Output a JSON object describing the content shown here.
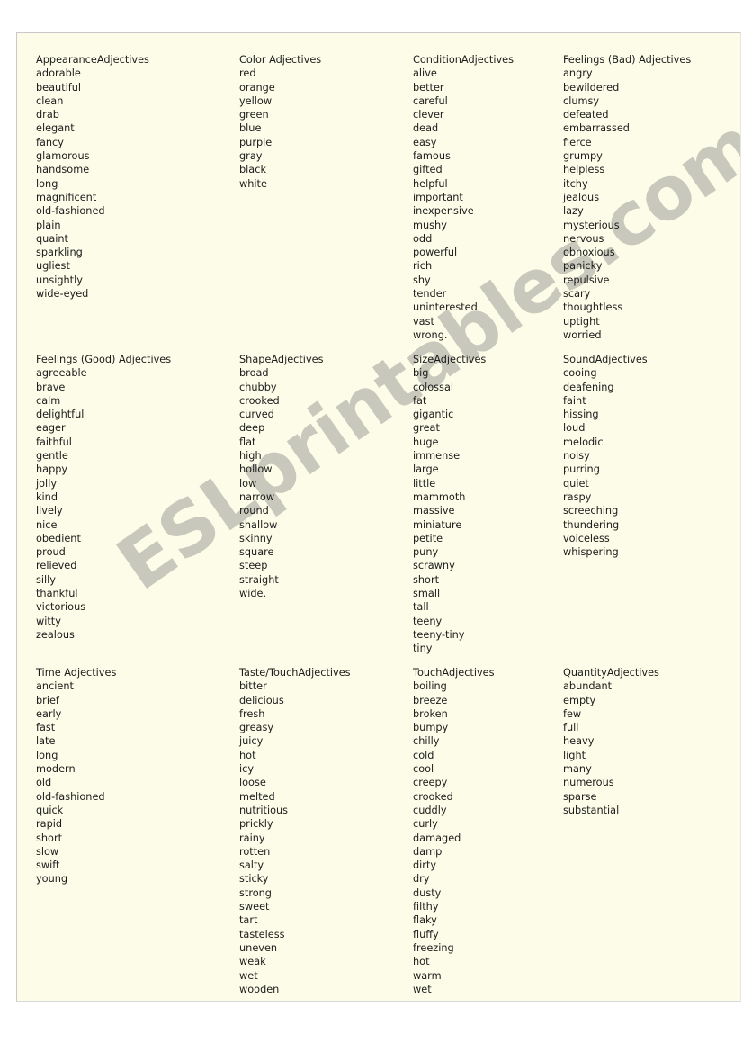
{
  "document": {
    "title": "Adjectives Word Bank",
    "watermark": "ESLprintables.com",
    "page_background": "#fcfce8",
    "text_color": "#1c1c1c",
    "watermark_color": "#c8c8bc"
  },
  "sections": [
    {
      "columns": [
        {
          "title": "AppearanceAdjectives",
          "words": [
            "adorable",
            "beautiful",
            "clean",
            "drab",
            "elegant",
            "fancy",
            "glamorous",
            "handsome",
            "long",
            "magnificent",
            "old-fashioned",
            "plain",
            "quaint",
            "sparkling",
            "ugliest",
            "unsightly",
            "wide-eyed"
          ]
        },
        {
          "title": "Color Adjectives",
          "words": [
            "red",
            "orange",
            "yellow",
            "green",
            "blue",
            "purple",
            "gray",
            "black",
            "white"
          ]
        },
        {
          "title": "ConditionAdjectives",
          "words": [
            "alive",
            "better",
            "careful",
            "clever",
            "dead",
            "easy",
            "famous",
            "gifted",
            "helpful",
            "important",
            "inexpensive",
            "mushy",
            "odd",
            "powerful",
            "rich",
            "shy",
            "tender",
            "uninterested",
            "vast",
            "wrong."
          ]
        },
        {
          "title": "Feelings (Bad) Adjectives",
          "words": [
            "angry",
            "bewildered",
            "clumsy",
            "defeated",
            "embarrassed",
            "fierce",
            "grumpy",
            "helpless",
            "itchy",
            "jealous",
            "lazy",
            "mysterious",
            "nervous",
            "obnoxious",
            "panicky",
            "repulsive",
            "scary",
            "thoughtless",
            "uptight",
            "worried"
          ]
        }
      ]
    },
    {
      "columns": [
        {
          "title": "Feelings (Good) Adjectives",
          "words": [
            "agreeable",
            "brave",
            "calm",
            "delightful",
            "eager",
            "faithful",
            "gentle",
            "happy",
            "jolly",
            "kind",
            "lively",
            "nice",
            "obedient",
            "proud",
            "relieved",
            "silly",
            "thankful",
            "victorious",
            "witty",
            "zealous"
          ]
        },
        {
          "title": "ShapeAdjectives",
          "words": [
            "broad",
            "chubby",
            "crooked",
            "curved",
            "deep",
            "flat",
            "high",
            "hollow",
            "low",
            "narrow",
            "round",
            "shallow",
            "skinny",
            "square",
            "steep",
            "straight",
            "wide."
          ]
        },
        {
          "title": "SizeAdjectives",
          "words": [
            "big",
            "colossal",
            "fat",
            "gigantic",
            "great",
            "huge",
            "immense",
            "large",
            "little",
            "mammoth",
            "massive",
            "miniature",
            "petite",
            "puny",
            "scrawny",
            "short",
            "small",
            "tall",
            "teeny",
            "teeny-tiny",
            "tiny"
          ]
        },
        {
          "title": "SoundAdjectives",
          "words": [
            "cooing",
            "deafening",
            "faint",
            "hissing",
            "loud",
            "melodic",
            "noisy",
            "purring",
            "quiet",
            "raspy",
            "screeching",
            "thundering",
            "voiceless",
            "whispering"
          ]
        }
      ]
    },
    {
      "columns": [
        {
          "title": "Time Adjectives",
          "words": [
            "ancient",
            "brief",
            "early",
            "fast",
            "late",
            "long",
            "modern",
            "old",
            "old-fashioned",
            "quick",
            "rapid",
            "short",
            "slow",
            "swift",
            "young"
          ]
        },
        {
          "title": "Taste/TouchAdjectives",
          "words": [
            "bitter",
            "delicious",
            "fresh",
            "greasy",
            "juicy",
            "hot",
            "icy",
            "loose",
            "melted",
            "nutritious",
            "prickly",
            "rainy",
            "rotten",
            "salty",
            "sticky",
            "strong",
            "sweet",
            "tart",
            "tasteless",
            "uneven",
            "weak",
            "wet",
            "wooden"
          ]
        },
        {
          "title": "TouchAdjectives",
          "words": [
            "boiling",
            "breeze",
            "broken",
            "bumpy",
            "chilly",
            "cold",
            "cool",
            "creepy",
            "crooked",
            "cuddly",
            "curly",
            "damaged",
            "damp",
            "dirty",
            "dry",
            "dusty",
            "filthy",
            "flaky",
            "fluffy",
            "freezing",
            "hot",
            "warm",
            "wet"
          ]
        },
        {
          "title": "QuantityAdjectives",
          "words": [
            "abundant",
            "empty",
            "few",
            "full",
            "heavy",
            "light",
            "many",
            "numerous",
            "sparse",
            "substantial"
          ]
        }
      ]
    }
  ]
}
